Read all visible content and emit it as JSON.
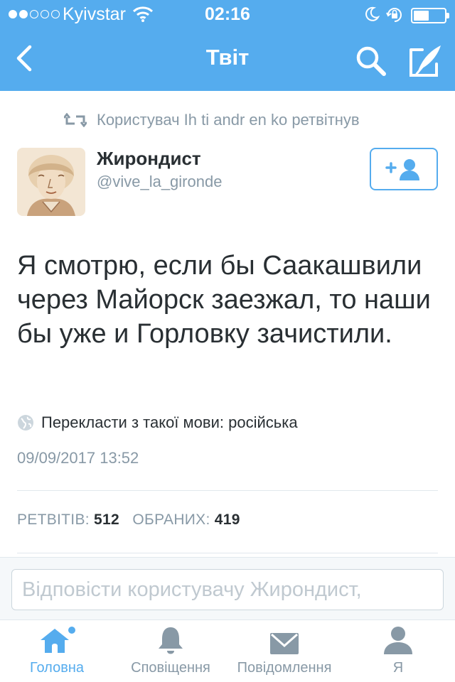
{
  "status_bar": {
    "carrier": "Kyivstar",
    "time": "02:16",
    "signal_bars_filled": 2,
    "signal_bars_total": 5,
    "battery_level": 0.5
  },
  "nav": {
    "title": "Твіт",
    "back_icon": "chevron-left-icon",
    "search_icon": "search-icon",
    "compose_icon": "compose-icon"
  },
  "retweet_note": "Користувач Ih ti andr en ko ретвітнув",
  "author": {
    "name": "Жирондист",
    "handle": "@vive_la_gironde"
  },
  "tweet": {
    "text": "Я смотрю, если бы Саакашвили через Майорск заезжал, то наши бы уже и Горловку зачистили.",
    "translate": "Перекласти з такої мови: російська",
    "date": "09/09/2017 13:52"
  },
  "stats": {
    "retweets_label": "РЕТВІТІВ:",
    "retweets": "512",
    "likes_label": "ОБРАНИХ:",
    "likes": "419"
  },
  "reply": {
    "placeholder": "Відповісти користувачу Жирондист,"
  },
  "tabs": [
    {
      "label": "Головна",
      "icon": "home-icon",
      "active": true
    },
    {
      "label": "Сповіщення",
      "icon": "bell-icon",
      "active": false
    },
    {
      "label": "Повідомлення",
      "icon": "envelope-icon",
      "active": false
    },
    {
      "label": "Я",
      "icon": "person-icon",
      "active": false
    }
  ],
  "colors": {
    "brand": "#55acee",
    "text": "#292f33",
    "muted": "#8899a6",
    "divider": "#e1e8ed"
  }
}
